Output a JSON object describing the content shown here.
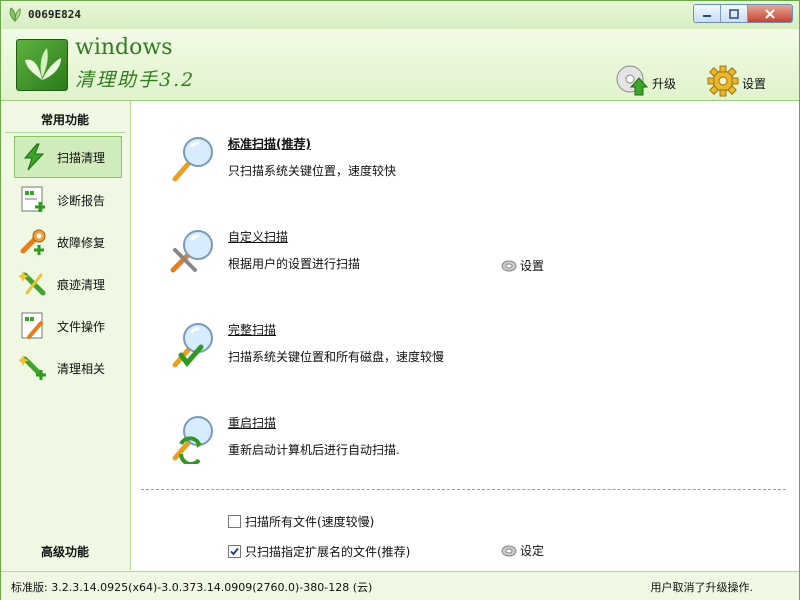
{
  "window": {
    "title": "0069E824"
  },
  "header": {
    "logo_title": "windows",
    "logo_subtitle": "清理助手3.2",
    "upgrade_label": "升级",
    "settings_label": "设置"
  },
  "sidebar": {
    "common_heading": "常用功能",
    "advanced_heading": "高级功能",
    "items": [
      {
        "label": "扫描清理",
        "icon": "scan-clean-icon"
      },
      {
        "label": "诊断报告",
        "icon": "report-icon"
      },
      {
        "label": "故障修复",
        "icon": "repair-icon"
      },
      {
        "label": "痕迹清理",
        "icon": "trace-clean-icon"
      },
      {
        "label": "文件操作",
        "icon": "file-ops-icon"
      },
      {
        "label": "清理相关",
        "icon": "clean-related-icon"
      }
    ]
  },
  "scans": [
    {
      "title": "标准扫描(推荐)",
      "desc": "只扫描系统关键位置，速度较快"
    },
    {
      "title": "自定义扫描",
      "desc": "根据用户的设置进行扫描",
      "link": "设置"
    },
    {
      "title": "完整扫描",
      "desc": "扫描系统关键位置和所有磁盘，速度较慢"
    },
    {
      "title": "重启扫描",
      "desc": "重新启动计算机后进行自动扫描."
    }
  ],
  "options": {
    "scan_all_files": {
      "label": "扫描所有文件(速度较慢)",
      "checked": false
    },
    "scan_ext_files": {
      "label": "只扫描指定扩展名的文件(推荐)",
      "checked": true
    },
    "ext_settings_link": "设定"
  },
  "status": {
    "version": "标准版: 3.2.3.14.0925(x64)-3.0.373.14.0909(2760.0)-380-128 (云)",
    "message": "用户取消了升级操作."
  },
  "colors": {
    "accent": "#2e7d1e",
    "sidebar_bg": "#eef8e2",
    "border": "#6aa84a"
  }
}
